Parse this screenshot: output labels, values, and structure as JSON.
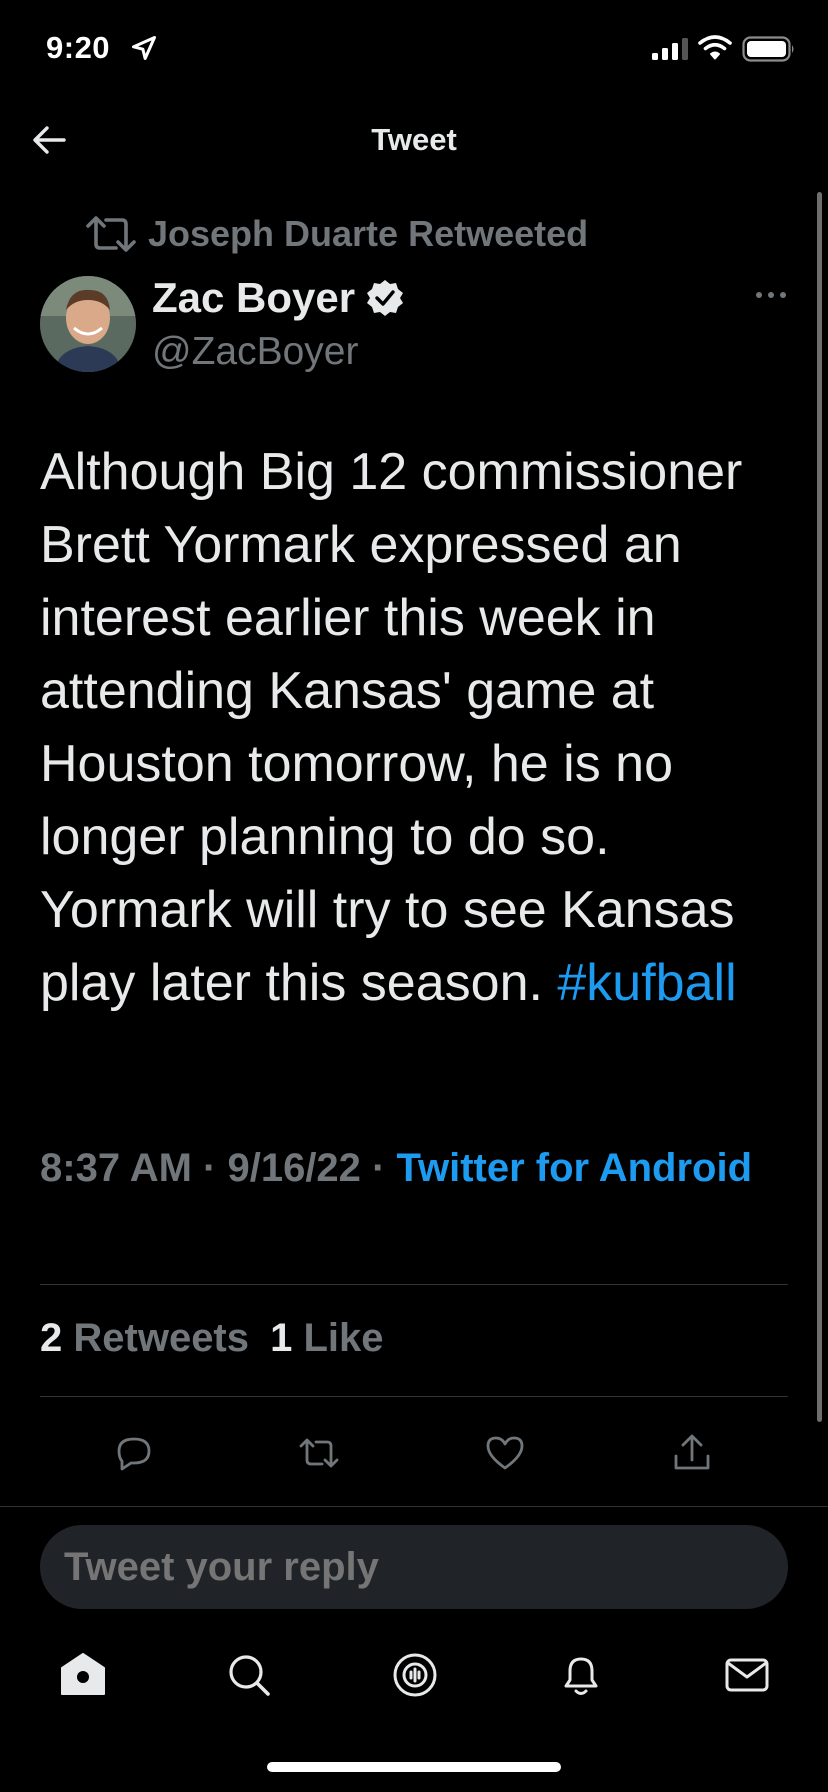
{
  "status_bar": {
    "time": "9:20"
  },
  "nav": {
    "title": "Tweet"
  },
  "tweet": {
    "retweeted_by": "Joseph Duarte Retweeted",
    "author_name": "Zac Boyer",
    "author_handle": "@ZacBoyer",
    "body_text": "Although Big 12 commissioner Brett Yormark expressed an interest earlier this week in attending Kansas' game at Houston tomorrow, he is no longer planning to do so. Yormark will try to see Kansas play later this season.",
    "hashtag": "#kufball",
    "time": "8:37 AM",
    "date": "9/16/22",
    "source": "Twitter for Android",
    "retweets_count": "2",
    "retweets_label": "Retweets",
    "likes_count": "1",
    "likes_label": "Like"
  },
  "reply": {
    "placeholder": "Tweet your reply"
  },
  "tabbar": {
    "items": [
      "home-icon",
      "search-icon",
      "spaces-icon",
      "notifications-icon",
      "messages-icon"
    ]
  },
  "colors": {
    "accent": "#1d9bf0",
    "muted": "#71767b",
    "text": "#e7e9ea",
    "background": "#000000"
  }
}
